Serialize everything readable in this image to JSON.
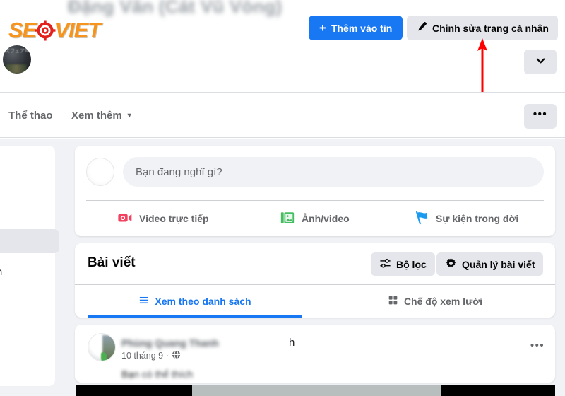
{
  "profile": {
    "display_name": "Đặng Văn (Cát Vũ Vòng)",
    "avatar_glyphs": "ズフェアR",
    "watermark": {
      "left": "SE",
      "right": "VIET",
      "color": "#f7941e",
      "accent": "#e3211c"
    }
  },
  "header_actions": {
    "add_story_label": "Thêm vào tin",
    "add_story_icon": "plus-icon",
    "edit_profile_label": "Chỉnh sửa trang cá nhân",
    "edit_profile_icon": "pencil-icon",
    "chevron_icon": "chevron-down-icon",
    "primary_color": "#1877f2",
    "secondary_color": "#e4e6eb"
  },
  "annotation": {
    "type": "arrow-up",
    "color": "#ff0000"
  },
  "nav": {
    "items": [
      {
        "label": "Thể thao",
        "caret": ""
      },
      {
        "label": "Xem thêm",
        "caret": "▾"
      }
    ],
    "more_icon": "ellipsis-icon",
    "more_label": "•••"
  },
  "sidebar": {
    "link_text": "imix.com"
  },
  "composer": {
    "placeholder": "Bạn đang nghĩ gì?",
    "value": "",
    "actions": [
      {
        "label": "Video trực tiếp",
        "icon": "live-video-icon",
        "color": "#f3425f"
      },
      {
        "label": "Ảnh/video",
        "icon": "photo-video-icon",
        "color": "#45bd62"
      },
      {
        "label": "Sự kiện trong đời",
        "icon": "life-event-flag-icon",
        "color": "#1b9bf0"
      }
    ]
  },
  "posts_panel": {
    "title": "Bài viết",
    "filter_label": "Bộ lọc",
    "filter_icon": "sliders-icon",
    "manage_label": "Quản lý bài viết",
    "manage_icon": "gear-icon",
    "tabs": [
      {
        "label": "Xem theo danh sách",
        "icon": "list-icon",
        "active": true
      },
      {
        "label": "Chế độ xem lưới",
        "icon": "grid-icon",
        "active": false
      }
    ],
    "active_color": "#1877f2"
  },
  "post": {
    "author": "Phùng Quang Thanh",
    "author_suffix": "h",
    "date": "10 tháng 9",
    "separator": "·",
    "audience_icon": "globe-icon",
    "body_first": "Bạ",
    "body_rest": "n có thể thích",
    "menu_icon": "ellipsis-icon",
    "menu_label": "•••"
  },
  "scrollbar": {
    "orientation": "horizontal",
    "track_color": "#000000",
    "thumb_color": "#b8bdbe"
  }
}
